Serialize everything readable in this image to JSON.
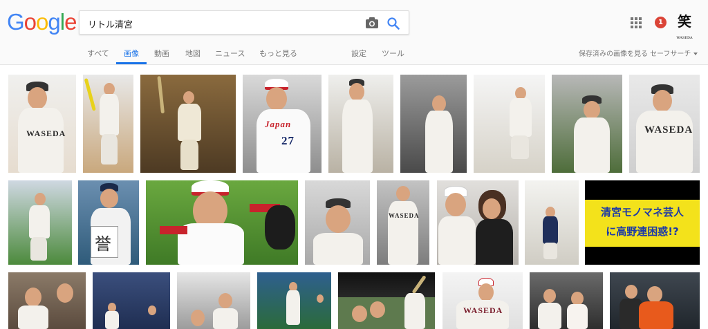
{
  "logo": {
    "letters": [
      "G",
      "o",
      "o",
      "g",
      "l",
      "e"
    ],
    "colors": [
      "#4285f4",
      "#ea4335",
      "#fbbc05",
      "#4285f4",
      "#34a853",
      "#ea4335"
    ]
  },
  "search": {
    "query": "リトル清宮"
  },
  "account": {
    "notification_count": "1",
    "avatar_glyph": "笑",
    "avatar_caption": "WASEDA"
  },
  "tabs": [
    "すべて",
    "画像",
    "動画",
    "地図",
    "ニュース",
    "もっと見る",
    "設定",
    "ツール"
  ],
  "active_tab": "画像",
  "right_links": {
    "saved": "保存済みの画像を見る",
    "safesearch": "セーフサーチ"
  },
  "banner": {
    "line1": "清宮モノマネ芸人",
    "line2": "に高野連困惑!?"
  },
  "thumb_text": {
    "japan": "Japan",
    "number": "27",
    "waseda": "WASEDA",
    "card_glyph": "誉"
  },
  "colors": {
    "accent": "#1a73e8",
    "notification": "#db4437",
    "banner_bg": "#f3e21b",
    "banner_text": "#1d3aa7"
  }
}
